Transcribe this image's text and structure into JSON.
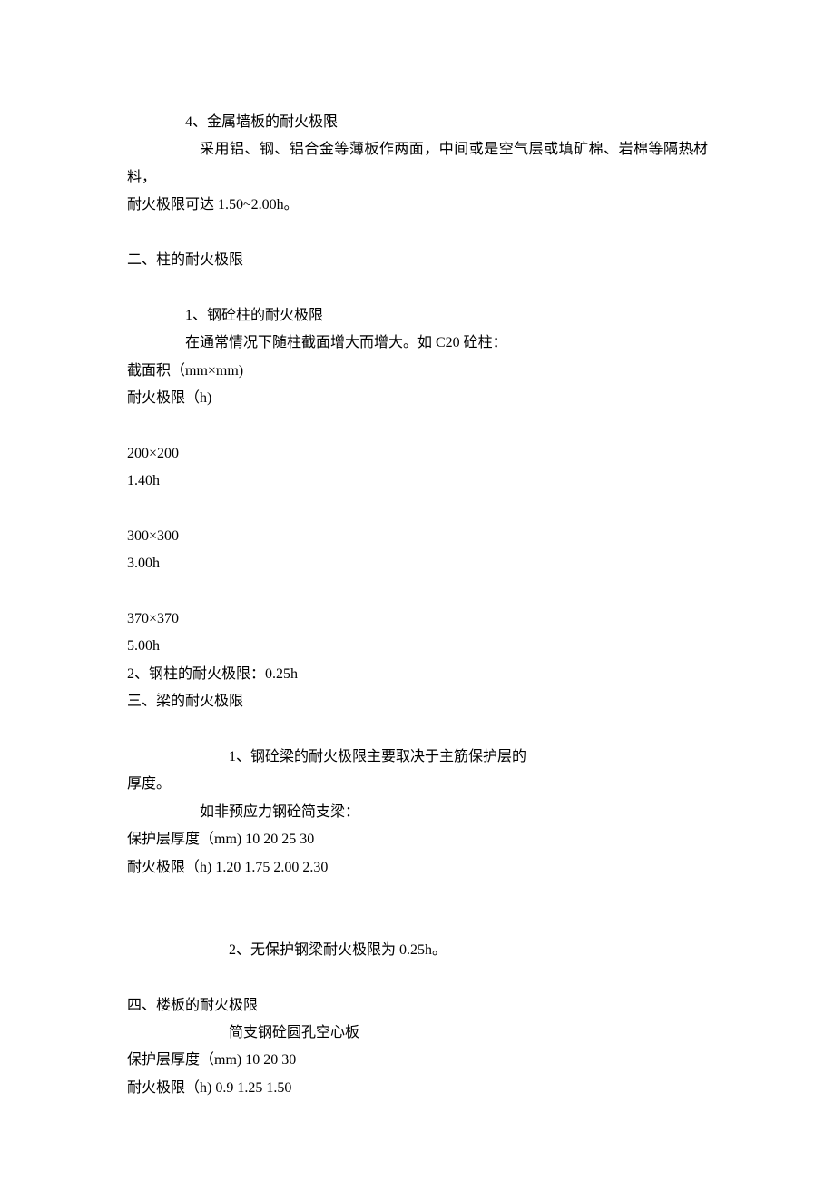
{
  "sec1": {
    "title": "4、金属墙板的耐火极限",
    "line1": "采用铝、钢、铝合金等薄板作两面，中间或是空气层或填矿棉、岩棉等隔热材料，",
    "line2": "耐火极限可达 1.50~2.00h。"
  },
  "sec2": {
    "heading": "二、柱的耐火极限",
    "sub1_title": "1、钢砼柱的耐火极限",
    "sub1_line": "在通常情况下随柱截面增大而增大。如 C20 砼柱：",
    "row_a": "截面积（mm×mm)",
    "row_b": "耐火极限（h)",
    "d1a": "200×200",
    "d1b": "1.40h",
    "d2a": "300×300",
    "d2b": "3.00h",
    "d3a": "370×370",
    "d3b": "5.00h",
    "sub2": "2、钢柱的耐火极限：0.25h"
  },
  "sec3": {
    "heading": "三、梁的耐火极限",
    "sub1_a": "1、钢砼梁的耐火极限主要取决于主筋保护层的",
    "sub1_b": "厚度。",
    "sub1_c": "如非预应力钢砼简支梁：",
    "row_a": "保护层厚度（mm)  10  20  25  30",
    "row_b": "耐火极限（h)   1.20  1.75  2.00  2.30",
    "sub2": "2、无保护钢梁耐火极限为 0.25h。"
  },
  "sec4": {
    "heading": "四、楼板的耐火极限",
    "sub": "简支钢砼圆孔空心板",
    "row_a": "保护层厚度（mm)  10  20  30",
    "row_b": "耐火极限（h)   0.9  1.25  1.50"
  }
}
